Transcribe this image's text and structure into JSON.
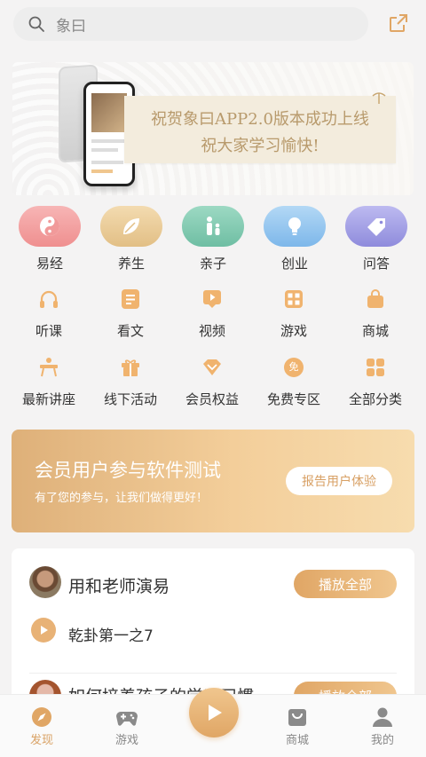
{
  "search": {
    "placeholder": "象曰"
  },
  "banner": {
    "line1": "祝贺象曰APP2.0版本成功上线",
    "line2": "祝大家学习愉快!"
  },
  "categories": [
    {
      "label": "易经",
      "icon": "yin-yang-icon",
      "color": "#f19a9a"
    },
    {
      "label": "养生",
      "icon": "leaf-icon",
      "color": "#e8c88f"
    },
    {
      "label": "亲子",
      "icon": "parent-child-icon",
      "color": "#7fc9b0"
    },
    {
      "label": "创业",
      "icon": "lightbulb-icon",
      "color": "#8fc4ee"
    },
    {
      "label": "问答",
      "icon": "tag-icon",
      "color": "#a6a3e6"
    }
  ],
  "grid": [
    {
      "label": "听课",
      "icon": "headphones-icon"
    },
    {
      "label": "看文",
      "icon": "document-icon"
    },
    {
      "label": "视频",
      "icon": "video-icon"
    },
    {
      "label": "游戏",
      "icon": "game-grid-icon"
    },
    {
      "label": "商城",
      "icon": "shopping-bag-icon"
    },
    {
      "label": "最新讲座",
      "icon": "lecture-icon"
    },
    {
      "label": "线下活动",
      "icon": "gift-icon"
    },
    {
      "label": "会员权益",
      "icon": "diamond-icon"
    },
    {
      "label": "免费专区",
      "icon": "free-badge-icon",
      "badge": "免"
    },
    {
      "label": "全部分类",
      "icon": "all-categories-icon"
    }
  ],
  "promo": {
    "title": "会员用户参与软件测试",
    "subtitle": "有了您的参与，让我们做得更好！",
    "button": "报告用户体验"
  },
  "playlist": {
    "title": "用和老师演易",
    "play_all": "播放全部",
    "track": "乾卦第一之7",
    "next_title": "如何培养孩子的学习习惯",
    "next_play_all": "播放全部"
  },
  "nav": [
    {
      "label": "发现",
      "icon": "compass-icon",
      "active": true
    },
    {
      "label": "游戏",
      "icon": "gamepad-icon",
      "active": false
    },
    {
      "label": "",
      "icon": "play-icon",
      "active": false
    },
    {
      "label": "商城",
      "icon": "store-icon",
      "active": false
    },
    {
      "label": "我的",
      "icon": "user-icon",
      "active": false
    }
  ],
  "colors": {
    "accent": "#e0a665",
    "accent_light": "#f0c68e",
    "icon_orange": "#f0b36e"
  }
}
